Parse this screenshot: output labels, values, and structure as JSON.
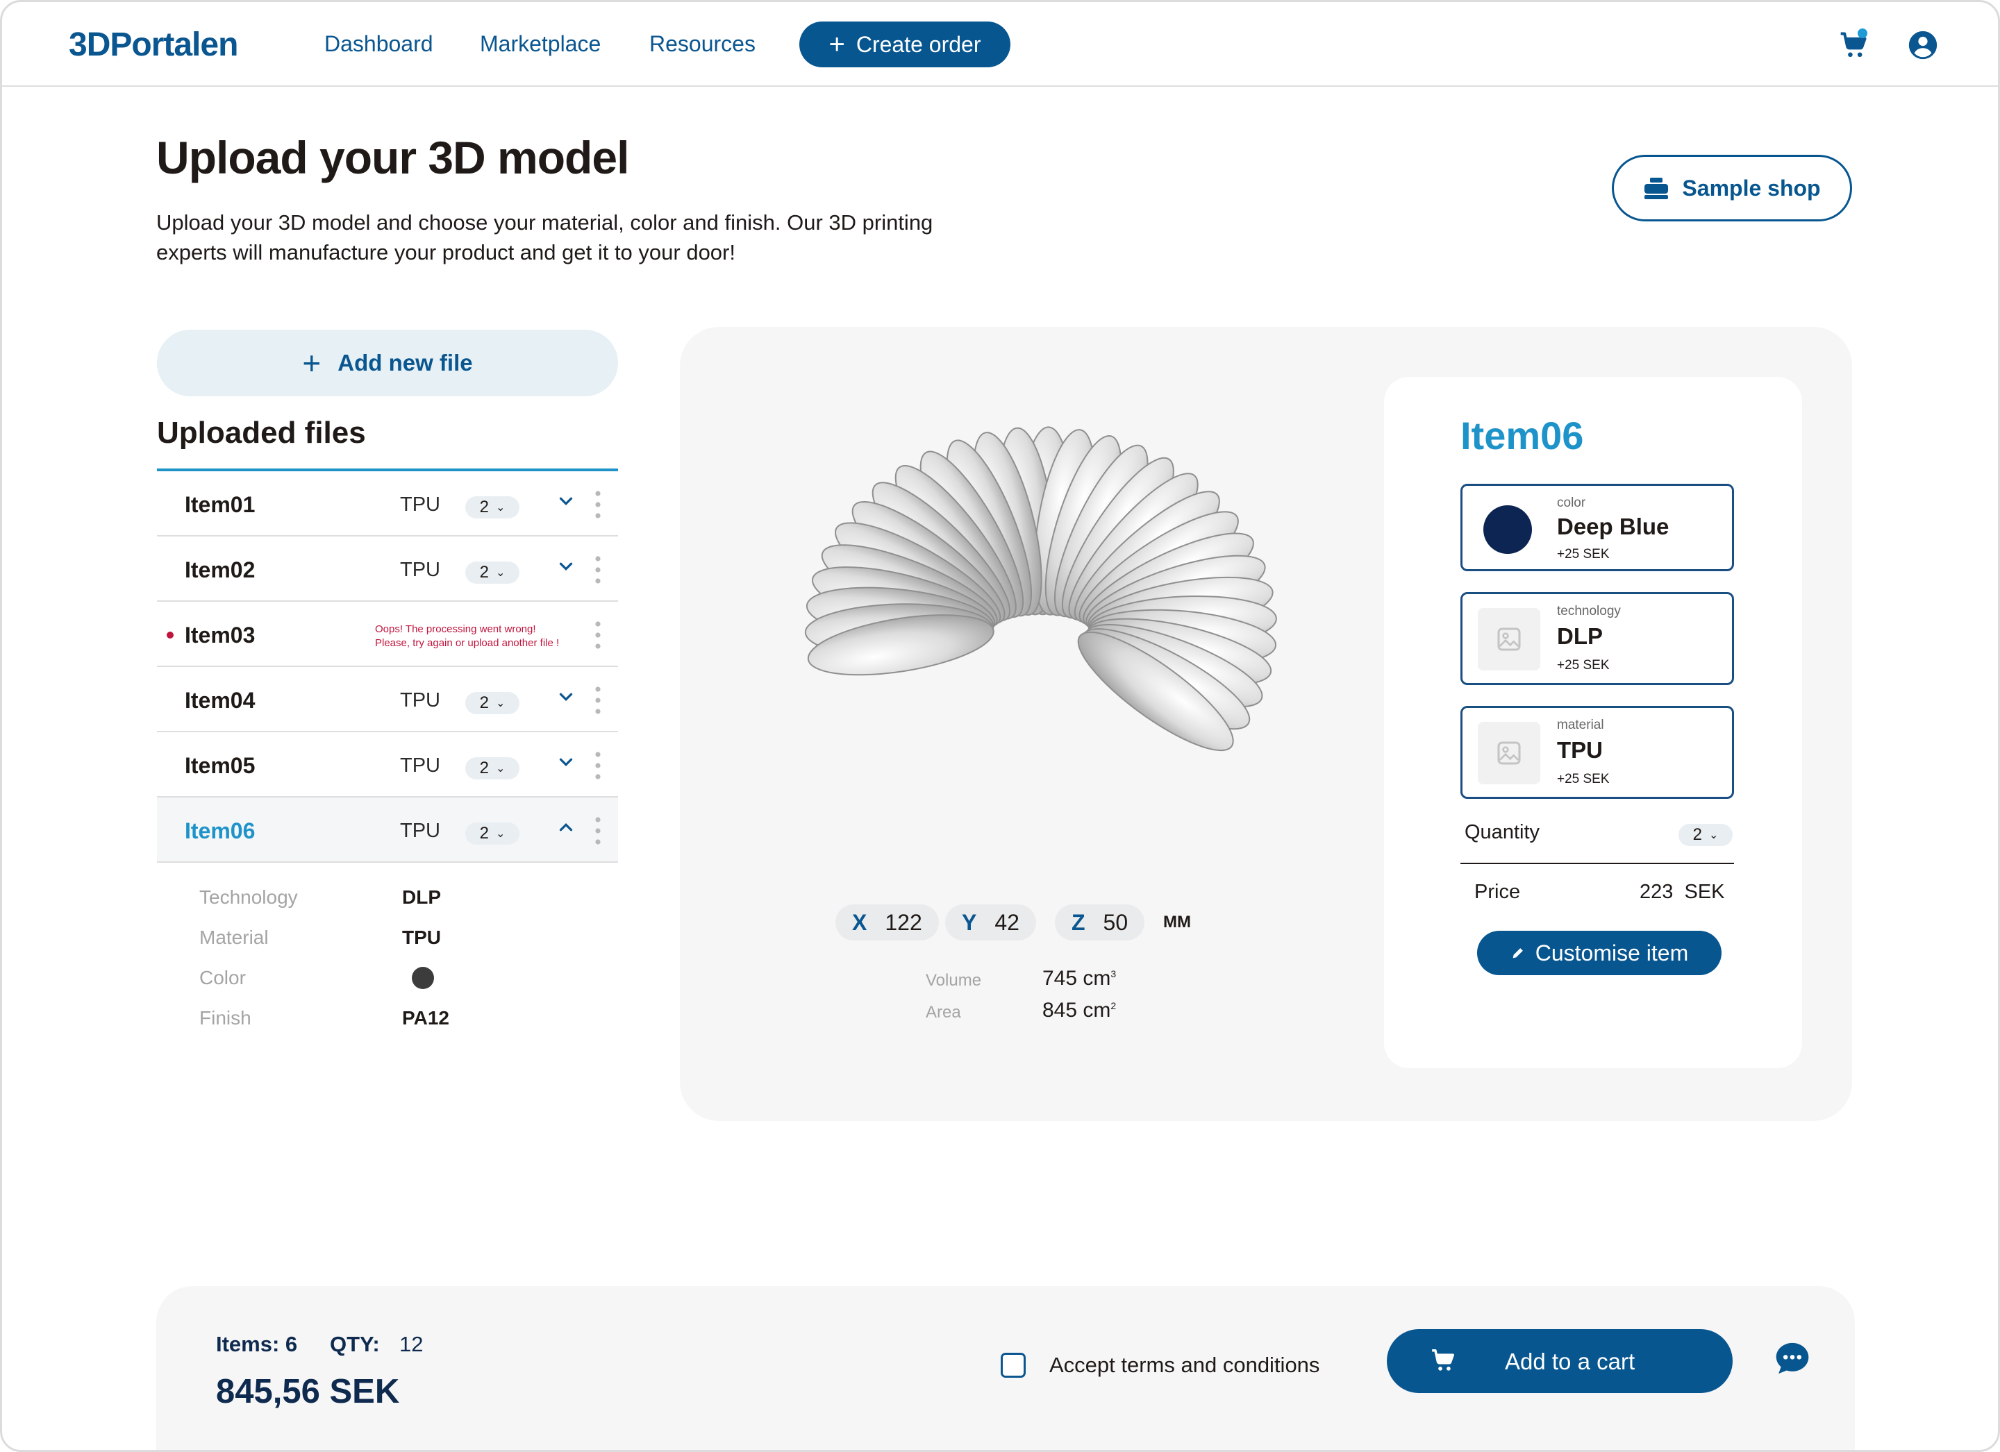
{
  "header": {
    "logo": "3DPortalen",
    "nav": [
      "Dashboard",
      "Marketplace",
      "Resources"
    ],
    "create_order": "Create order",
    "cart_icon": "cart-icon",
    "user_icon": "user-circle-icon"
  },
  "intro": {
    "title": "Upload your 3D model",
    "subtitle": "Upload your 3D model and choose your material, color and finish. Our 3D printing experts will manufacture your product and get it to your door!",
    "sample_shop": "Sample shop"
  },
  "files": {
    "add_new": "Add new file",
    "heading": "Uploaded files",
    "rows": [
      {
        "name": "Item01",
        "material": "TPU",
        "qty": "2"
      },
      {
        "name": "Item02",
        "material": "TPU",
        "qty": "2"
      },
      {
        "name": "Item03",
        "error_line1": "Oops! The processing went wrong!",
        "error_line2": "Please, try again or upload another file !"
      },
      {
        "name": "Item04",
        "material": "TPU",
        "qty": "2"
      },
      {
        "name": "Item05",
        "material": "TPU",
        "qty": "2"
      },
      {
        "name": "Item06",
        "material": "TPU",
        "qty": "2"
      }
    ],
    "details": [
      {
        "label": "Technology",
        "value": "DLP"
      },
      {
        "label": "Material",
        "value": "TPU"
      },
      {
        "label": "Color",
        "value": ""
      },
      {
        "label": "Finish",
        "value": "PA12"
      }
    ],
    "detail_color_hex": "#3c3c3c"
  },
  "viewer": {
    "dims": [
      {
        "axis": "X",
        "value": "122"
      },
      {
        "axis": "Y",
        "value": "42"
      },
      {
        "axis": "Z",
        "value": "50"
      }
    ],
    "unit": "MM",
    "volume_label": "Volume",
    "volume_value": "745 cm",
    "volume_exp": "3",
    "area_label": "Area",
    "area_value": "845 cm",
    "area_exp": "2"
  },
  "card": {
    "title": "Item06",
    "options": [
      {
        "label": "color",
        "value": "Deep Blue",
        "price": "+25 SEK",
        "swatch": "#0c2552"
      },
      {
        "label": "technology",
        "value": "DLP",
        "price": "+25 SEK"
      },
      {
        "label": "material",
        "value": "TPU",
        "price": "+25 SEK"
      }
    ],
    "quantity_label": "Quantity",
    "quantity_value": "2",
    "price_label": "Price",
    "price_value": "223  SEK",
    "customise": "Customise item"
  },
  "footer": {
    "items": "Items: 6",
    "qty_label": "QTY:",
    "qty_value": "12",
    "total": "845,56 SEK",
    "terms": "Accept terms and conditions",
    "add_to_cart": "Add to a cart",
    "chat_icon": "chat-bubble-icon"
  },
  "colors": {
    "brand": "#075690",
    "accent": "#1e93c9",
    "error": "#c0143c",
    "ink": "#0e2a4e"
  }
}
